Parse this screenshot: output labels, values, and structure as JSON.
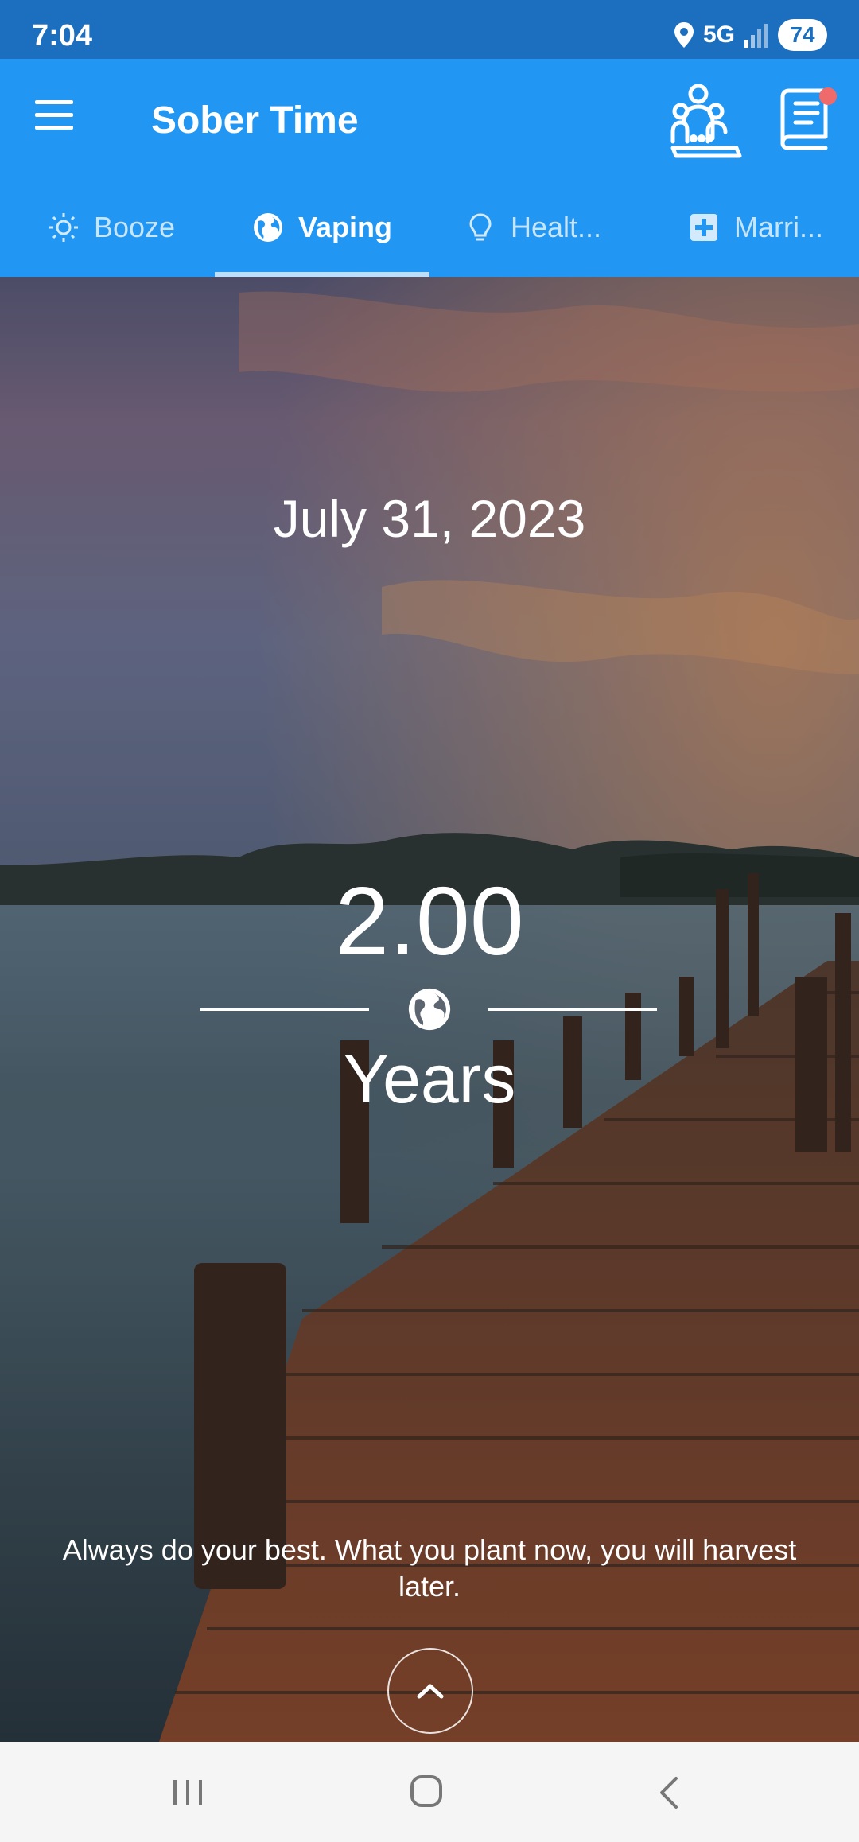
{
  "status_bar": {
    "time": "7:04",
    "network": "5G",
    "battery": "74"
  },
  "app_bar": {
    "title": "Sober Time",
    "menu_icon": "hamburger-menu-icon",
    "community_icon": "community-people-icon",
    "journal_icon": "journal-notebook-icon",
    "accent_color": "#2196f3"
  },
  "tabs": [
    {
      "label": "Booze",
      "icon": "sun-icon",
      "active": false
    },
    {
      "label": "Vaping",
      "icon": "globe-icon",
      "active": true
    },
    {
      "label": "Healt...",
      "icon": "lightbulb-icon",
      "active": false
    },
    {
      "label": "Marri...",
      "icon": "medical-cross-icon",
      "active": false
    }
  ],
  "counter": {
    "date": "July 31, 2023",
    "value": "2.00",
    "unit": "Years",
    "icon": "globe-icon"
  },
  "quote": "Always do your best. What you plant now, you will harvest later.",
  "expand_icon": "chevron-up-icon",
  "nav_bar": {
    "recents_icon": "recents-icon",
    "home_icon": "home-icon",
    "back_icon": "back-icon"
  }
}
